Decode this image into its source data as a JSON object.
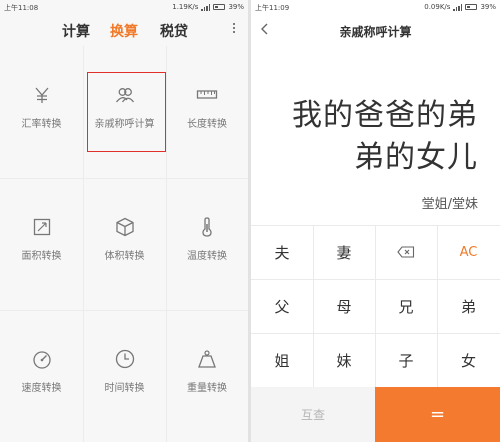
{
  "left": {
    "status": {
      "time": "上午11:08",
      "speed": "1.19K/s",
      "battery": "39%"
    },
    "tabs": [
      "计算",
      "换算",
      "税贷"
    ],
    "active_tab": 1,
    "items": [
      {
        "label": "汇率转换",
        "icon": "yen-icon"
      },
      {
        "label": "亲戚称呼计算",
        "icon": "people-icon",
        "highlighted": true
      },
      {
        "label": "长度转换",
        "icon": "ruler-icon"
      },
      {
        "label": "面积转换",
        "icon": "area-icon"
      },
      {
        "label": "体积转换",
        "icon": "cube-icon"
      },
      {
        "label": "温度转换",
        "icon": "thermometer-icon"
      },
      {
        "label": "速度转换",
        "icon": "speedometer-icon"
      },
      {
        "label": "时间转换",
        "icon": "clock-icon"
      },
      {
        "label": "重量转换",
        "icon": "weight-icon"
      }
    ]
  },
  "right": {
    "status": {
      "time": "上午11:09",
      "speed": "0.09K/s",
      "battery": "39%"
    },
    "title": "亲戚称呼计算",
    "display": {
      "line1": "我的爸爸的弟",
      "line2": "弟的女儿"
    },
    "result": "堂姐/堂妹",
    "keys": [
      [
        "夫",
        "妻",
        "⌫",
        "AC"
      ],
      [
        "父",
        "母",
        "兄",
        "弟"
      ],
      [
        "姐",
        "妹",
        "子",
        "女"
      ]
    ],
    "mutual_label": "互查",
    "equals_label": "="
  },
  "colors": {
    "accent": "#f07a2a",
    "highlight_border": "#e0302a",
    "equals_bg": "#f47a30"
  }
}
